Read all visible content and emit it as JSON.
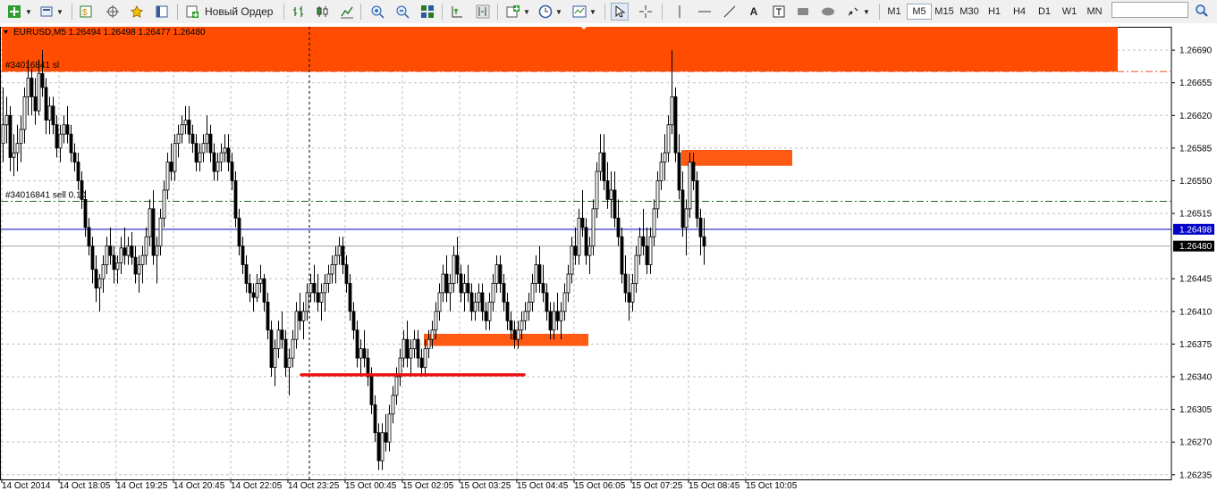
{
  "toolbar": {
    "new_order_label": "Новый Ордер",
    "timeframes": [
      "M1",
      "M5",
      "M15",
      "M30",
      "H1",
      "H4",
      "D1",
      "W1",
      "MN"
    ],
    "active_timeframe": "M5",
    "icons": [
      "new-chart-icon",
      "profiles-icon",
      "market-watch-icon",
      "navigator-icon",
      "favorites-icon",
      "data-window-icon",
      "new-order-icon",
      "bar-chart-icon",
      "candlestick-icon",
      "line-chart-icon",
      "zoom-in-icon",
      "zoom-out-icon",
      "tile-windows-icon",
      "autoscroll-icon",
      "chart-shift-icon",
      "indicators-icon",
      "periods-icon",
      "templates-icon",
      "cursor-icon",
      "crosshair-icon",
      "vertical-line-icon",
      "horizontal-line-icon",
      "trendline-icon",
      "text-icon",
      "text-label-icon",
      "rectangle-icon",
      "ellipse-icon",
      "arrows-icon",
      "search-icon"
    ]
  },
  "chart_data": {
    "type": "candlestick",
    "header": "EURUSD,M5  1.26494 1.26498 1.26477 1.26480",
    "symbol": "EURUSD",
    "timeframe": "M5",
    "ohlc": {
      "open": 1.26494,
      "high": 1.26498,
      "low": 1.26477,
      "close": 1.2648
    },
    "price_axis": {
      "min": 1.2623,
      "max": 1.26715,
      "ticks": [
        "1.26690",
        "1.26655",
        "1.26620",
        "1.26585",
        "1.26550",
        "1.26515",
        "1.26445",
        "1.26410",
        "1.26375",
        "1.26340",
        "1.26305",
        "1.26270",
        "1.26235"
      ]
    },
    "time_labels": [
      "14 Oct 2014",
      "14 Oct 18:05",
      "14 Oct 19:25",
      "14 Oct 20:45",
      "14 Oct 22:05",
      "14 Oct 23:25",
      "15 Oct 00:45",
      "15 Oct 02:05",
      "15 Oct 03:25",
      "15 Oct 04:45",
      "15 Oct 06:05",
      "15 Oct 07:25",
      "15 Oct 08:45",
      "15 Oct 10:05"
    ],
    "price_markers": [
      {
        "label": "1.26498",
        "price": 1.26498,
        "bg": "#0000c8",
        "fg": "#ffffff",
        "kind": "bid"
      },
      {
        "label": "1.26480",
        "price": 1.2648,
        "bg": "#000000",
        "fg": "#ffffff",
        "kind": "last"
      }
    ],
    "order_lines": [
      {
        "label": "#34016841 sl",
        "price": 1.26667,
        "color": "#e05020",
        "style": "dashdot"
      },
      {
        "label": "#34016841 sell 0.10",
        "price": 1.26528,
        "color": "#1f6b1f",
        "style": "dashdot"
      }
    ],
    "zones": [
      {
        "price_top": 1.26715,
        "price_bottom": 1.26667,
        "bar_from": 0,
        "bar_to": 312,
        "color": "#ff4c00"
      },
      {
        "price_top": 1.26583,
        "price_bottom": 1.26566,
        "bar_from": 190,
        "bar_to": 221,
        "color": "#ff5a14"
      },
      {
        "price_top": 1.26386,
        "price_bottom": 1.26373,
        "bar_from": 118,
        "bar_to": 164,
        "color": "#ff5a14"
      }
    ],
    "trend_line": {
      "from_bar": 84,
      "to_bar": 146,
      "price": 1.26342,
      "color": "#ee1111"
    },
    "vertical_marker_bar": 86,
    "candle_color": "#000000",
    "accent_colors": {
      "zone": "#ff4c00",
      "bid_line": "#0000c8",
      "sell_line": "#1f6b1f",
      "grid": "#c0c0c0"
    },
    "candles": [
      [
        1.2659,
        1.2665,
        1.2657,
        1.2661
      ],
      [
        1.2661,
        1.2664,
        1.2659,
        1.2662
      ],
      [
        1.2662,
        1.2663,
        1.2656,
        1.26575
      ],
      [
        1.26575,
        1.266,
        1.26555,
        1.2658
      ],
      [
        1.2658,
        1.2661,
        1.2656,
        1.2659
      ],
      [
        1.2659,
        1.2662,
        1.2657,
        1.26605
      ],
      [
        1.26605,
        1.2665,
        1.2659,
        1.2664
      ],
      [
        1.2664,
        1.2668,
        1.2662,
        1.2666
      ],
      [
        1.2666,
        1.2667,
        1.2662,
        1.2664
      ],
      [
        1.2664,
        1.2666,
        1.2661,
        1.26625
      ],
      [
        1.26625,
        1.2668,
        1.2662,
        1.26665
      ],
      [
        1.26665,
        1.2669,
        1.2664,
        1.2665
      ],
      [
        1.2665,
        1.2666,
        1.266,
        1.26615
      ],
      [
        1.26615,
        1.2664,
        1.266,
        1.2663
      ],
      [
        1.2663,
        1.2664,
        1.266,
        1.2661
      ],
      [
        1.2661,
        1.2662,
        1.26575,
        1.26585
      ],
      [
        1.26585,
        1.2661,
        1.2657,
        1.266
      ],
      [
        1.266,
        1.2662,
        1.2659,
        1.2661
      ],
      [
        1.2661,
        1.2663,
        1.2659,
        1.266
      ],
      [
        1.266,
        1.2661,
        1.2657,
        1.2658
      ],
      [
        1.2658,
        1.2659,
        1.2656,
        1.2657
      ],
      [
        1.2657,
        1.2658,
        1.2654,
        1.2655
      ],
      [
        1.2655,
        1.2656,
        1.2652,
        1.2653
      ],
      [
        1.2653,
        1.2654,
        1.2649,
        1.265
      ],
      [
        1.265,
        1.2651,
        1.2647,
        1.2648
      ],
      [
        1.2648,
        1.2649,
        1.2644,
        1.26455
      ],
      [
        1.26455,
        1.2647,
        1.2642,
        1.26435
      ],
      [
        1.26435,
        1.2645,
        1.2641,
        1.26445
      ],
      [
        1.26445,
        1.2647,
        1.2643,
        1.2646
      ],
      [
        1.2646,
        1.2649,
        1.2645,
        1.2648
      ],
      [
        1.2648,
        1.265,
        1.2646,
        1.2647
      ],
      [
        1.2647,
        1.2648,
        1.2644,
        1.26455
      ],
      [
        1.26455,
        1.2647,
        1.2644,
        1.26462
      ],
      [
        1.26462,
        1.2649,
        1.2645,
        1.26478
      ],
      [
        1.26478,
        1.265,
        1.2646,
        1.2647
      ],
      [
        1.2647,
        1.2649,
        1.2646,
        1.2648
      ],
      [
        1.2648,
        1.26495,
        1.2646,
        1.26468
      ],
      [
        1.26468,
        1.2648,
        1.2644,
        1.2645
      ],
      [
        1.2645,
        1.2647,
        1.2643,
        1.2646
      ],
      [
        1.2646,
        1.2648,
        1.2644,
        1.2647
      ],
      [
        1.2647,
        1.265,
        1.2646,
        1.2649
      ],
      [
        1.2649,
        1.2653,
        1.2648,
        1.2652
      ],
      [
        1.2652,
        1.2654,
        1.2646,
        1.2647
      ],
      [
        1.2647,
        1.2649,
        1.2644,
        1.2648
      ],
      [
        1.2648,
        1.2652,
        1.2647,
        1.2651
      ],
      [
        1.2651,
        1.2655,
        1.265,
        1.2654
      ],
      [
        1.2654,
        1.2658,
        1.2653,
        1.2657
      ],
      [
        1.2657,
        1.2659,
        1.2655,
        1.2656
      ],
      [
        1.2656,
        1.266,
        1.2655,
        1.2659
      ],
      [
        1.2659,
        1.2661,
        1.26575,
        1.266
      ],
      [
        1.266,
        1.2662,
        1.2659,
        1.2661
      ],
      [
        1.2661,
        1.2663,
        1.266,
        1.26615
      ],
      [
        1.26615,
        1.2663,
        1.2659,
        1.266
      ],
      [
        1.266,
        1.2661,
        1.2658,
        1.2659
      ],
      [
        1.2659,
        1.266,
        1.2656,
        1.2657
      ],
      [
        1.2657,
        1.2659,
        1.2656,
        1.2658
      ],
      [
        1.2658,
        1.266,
        1.2657,
        1.2659
      ],
      [
        1.2659,
        1.2662,
        1.2658,
        1.266
      ],
      [
        1.266,
        1.2661,
        1.2657,
        1.2658
      ],
      [
        1.2658,
        1.2659,
        1.2655,
        1.2656
      ],
      [
        1.2656,
        1.2658,
        1.2655,
        1.2657
      ],
      [
        1.2657,
        1.2659,
        1.2656,
        1.2658
      ],
      [
        1.2658,
        1.266,
        1.2657,
        1.26585
      ],
      [
        1.26585,
        1.266,
        1.2656,
        1.2657
      ],
      [
        1.2657,
        1.2658,
        1.2654,
        1.2655
      ],
      [
        1.2655,
        1.2656,
        1.265,
        1.2651
      ],
      [
        1.2651,
        1.2652,
        1.2647,
        1.2648
      ],
      [
        1.2648,
        1.2649,
        1.2645,
        1.2646
      ],
      [
        1.2646,
        1.2647,
        1.2643,
        1.2644
      ],
      [
        1.2644,
        1.2645,
        1.2642,
        1.2643
      ],
      [
        1.2643,
        1.2644,
        1.2641,
        1.26425
      ],
      [
        1.26425,
        1.2645,
        1.2642,
        1.2644
      ],
      [
        1.2644,
        1.2646,
        1.2643,
        1.26445
      ],
      [
        1.26445,
        1.2645,
        1.2641,
        1.2642
      ],
      [
        1.2642,
        1.2643,
        1.2638,
        1.2639
      ],
      [
        1.2639,
        1.264,
        1.2634,
        1.2635
      ],
      [
        1.2635,
        1.2638,
        1.2633,
        1.2637
      ],
      [
        1.2637,
        1.264,
        1.2636,
        1.2639
      ],
      [
        1.2639,
        1.2641,
        1.2637,
        1.2638
      ],
      [
        1.2638,
        1.2639,
        1.2634,
        1.2635
      ],
      [
        1.2635,
        1.2637,
        1.2632,
        1.2636
      ],
      [
        1.2636,
        1.2639,
        1.2635,
        1.2638
      ],
      [
        1.2638,
        1.2642,
        1.2637,
        1.2641
      ],
      [
        1.2641,
        1.2643,
        1.2639,
        1.264
      ],
      [
        1.264,
        1.2642,
        1.2638,
        1.2641
      ],
      [
        1.2641,
        1.2644,
        1.264,
        1.2643
      ],
      [
        1.2643,
        1.2645,
        1.2642,
        1.2644
      ],
      [
        1.2644,
        1.2646,
        1.2642,
        1.2643
      ],
      [
        1.2643,
        1.2645,
        1.2641,
        1.2642
      ],
      [
        1.2642,
        1.2644,
        1.264,
        1.2643
      ],
      [
        1.2643,
        1.2645,
        1.2641,
        1.2644
      ],
      [
        1.2644,
        1.2646,
        1.2643,
        1.2645
      ],
      [
        1.2645,
        1.2647,
        1.2644,
        1.2646
      ],
      [
        1.2646,
        1.2648,
        1.2644,
        1.2647
      ],
      [
        1.2647,
        1.2649,
        1.2646,
        1.2648
      ],
      [
        1.2648,
        1.2649,
        1.2645,
        1.2646
      ],
      [
        1.2646,
        1.2647,
        1.2643,
        1.2644
      ],
      [
        1.2644,
        1.2645,
        1.264,
        1.2641
      ],
      [
        1.2641,
        1.2642,
        1.2638,
        1.2639
      ],
      [
        1.2639,
        1.264,
        1.2635,
        1.2636
      ],
      [
        1.2636,
        1.2638,
        1.2634,
        1.2637
      ],
      [
        1.2637,
        1.2639,
        1.2635,
        1.2636
      ],
      [
        1.2636,
        1.2637,
        1.2633,
        1.2634
      ],
      [
        1.2634,
        1.2635,
        1.263,
        1.2631
      ],
      [
        1.2631,
        1.2632,
        1.2627,
        1.2628
      ],
      [
        1.2628,
        1.2629,
        1.2624,
        1.2625
      ],
      [
        1.2625,
        1.2629,
        1.2624,
        1.2628
      ],
      [
        1.2628,
        1.263,
        1.2626,
        1.2627
      ],
      [
        1.2627,
        1.2631,
        1.2626,
        1.263
      ],
      [
        1.263,
        1.2633,
        1.2629,
        1.2632
      ],
      [
        1.2632,
        1.2635,
        1.2631,
        1.2634
      ],
      [
        1.2634,
        1.2637,
        1.2633,
        1.2636
      ],
      [
        1.2636,
        1.2639,
        1.2635,
        1.2638
      ],
      [
        1.2638,
        1.264,
        1.2635,
        1.2636
      ],
      [
        1.2636,
        1.2638,
        1.2634,
        1.2637
      ],
      [
        1.2637,
        1.2639,
        1.2636,
        1.2638
      ],
      [
        1.2638,
        1.2639,
        1.2635,
        1.2636
      ],
      [
        1.2636,
        1.2637,
        1.2634,
        1.2635
      ],
      [
        1.2635,
        1.2638,
        1.2634,
        1.2637
      ],
      [
        1.2637,
        1.2639,
        1.2636,
        1.2638
      ],
      [
        1.2638,
        1.264,
        1.2637,
        1.2639
      ],
      [
        1.2639,
        1.2642,
        1.2638,
        1.2641
      ],
      [
        1.2641,
        1.2644,
        1.264,
        1.2643
      ],
      [
        1.2643,
        1.2646,
        1.2642,
        1.2645
      ],
      [
        1.2645,
        1.2647,
        1.2642,
        1.2643
      ],
      [
        1.2643,
        1.2645,
        1.2641,
        1.2644
      ],
      [
        1.2644,
        1.2648,
        1.2643,
        1.2647
      ],
      [
        1.2647,
        1.2649,
        1.2644,
        1.2645
      ],
      [
        1.2645,
        1.2646,
        1.2642,
        1.2643
      ],
      [
        1.2643,
        1.2645,
        1.2641,
        1.2644
      ],
      [
        1.2644,
        1.2646,
        1.2642,
        1.2643
      ],
      [
        1.2643,
        1.2644,
        1.264,
        1.2641
      ],
      [
        1.2641,
        1.2643,
        1.264,
        1.2642
      ],
      [
        1.2642,
        1.2644,
        1.2641,
        1.2643
      ],
      [
        1.2643,
        1.2644,
        1.264,
        1.2641
      ],
      [
        1.2641,
        1.2642,
        1.2639,
        1.264
      ],
      [
        1.264,
        1.2643,
        1.2639,
        1.2642
      ],
      [
        1.2642,
        1.2645,
        1.2641,
        1.2644
      ],
      [
        1.2644,
        1.2647,
        1.2643,
        1.2646
      ],
      [
        1.2646,
        1.2647,
        1.2643,
        1.2644
      ],
      [
        1.2644,
        1.2645,
        1.2641,
        1.2642
      ],
      [
        1.2642,
        1.2643,
        1.2639,
        1.264
      ],
      [
        1.264,
        1.2641,
        1.2638,
        1.2639
      ],
      [
        1.2639,
        1.264,
        1.2637,
        1.2638
      ],
      [
        1.2638,
        1.264,
        1.2637,
        1.2639
      ],
      [
        1.2639,
        1.2641,
        1.2638,
        1.264
      ],
      [
        1.264,
        1.2642,
        1.2639,
        1.2641
      ],
      [
        1.2641,
        1.2643,
        1.264,
        1.2642
      ],
      [
        1.2642,
        1.2645,
        1.2641,
        1.2644
      ],
      [
        1.2644,
        1.2647,
        1.2643,
        1.2646
      ],
      [
        1.2646,
        1.2648,
        1.2643,
        1.2644
      ],
      [
        1.2644,
        1.2646,
        1.2642,
        1.2643
      ],
      [
        1.2643,
        1.2644,
        1.264,
        1.2641
      ],
      [
        1.2641,
        1.2642,
        1.2638,
        1.2639
      ],
      [
        1.2639,
        1.2642,
        1.2638,
        1.2641
      ],
      [
        1.2641,
        1.2643,
        1.2639,
        1.264
      ],
      [
        1.264,
        1.2642,
        1.2638,
        1.2641
      ],
      [
        1.2641,
        1.2644,
        1.264,
        1.2643
      ],
      [
        1.2643,
        1.2646,
        1.2642,
        1.2645
      ],
      [
        1.2645,
        1.2649,
        1.2644,
        1.2648
      ],
      [
        1.2648,
        1.265,
        1.2646,
        1.2647
      ],
      [
        1.2647,
        1.2652,
        1.2646,
        1.2651
      ],
      [
        1.2651,
        1.2654,
        1.2649,
        1.265
      ],
      [
        1.265,
        1.2651,
        1.2646,
        1.2647
      ],
      [
        1.2647,
        1.2649,
        1.2645,
        1.2648
      ],
      [
        1.2648,
        1.2653,
        1.2647,
        1.2652
      ],
      [
        1.2652,
        1.2657,
        1.2651,
        1.2656
      ],
      [
        1.2656,
        1.266,
        1.2655,
        1.2658
      ],
      [
        1.2658,
        1.266,
        1.2654,
        1.2655
      ],
      [
        1.2655,
        1.2657,
        1.2652,
        1.2653
      ],
      [
        1.2653,
        1.2656,
        1.2651,
        1.2654
      ],
      [
        1.2654,
        1.2656,
        1.265,
        1.2651
      ],
      [
        1.2651,
        1.2653,
        1.2648,
        1.2649
      ],
      [
        1.2649,
        1.265,
        1.2644,
        1.2645
      ],
      [
        1.2645,
        1.2647,
        1.2642,
        1.2643
      ],
      [
        1.2643,
        1.2645,
        1.264,
        1.2642
      ],
      [
        1.2642,
        1.2645,
        1.2641,
        1.2644
      ],
      [
        1.2644,
        1.2648,
        1.2643,
        1.2647
      ],
      [
        1.2647,
        1.265,
        1.2646,
        1.2649
      ],
      [
        1.2649,
        1.2652,
        1.2647,
        1.2648
      ],
      [
        1.2648,
        1.265,
        1.2645,
        1.2646
      ],
      [
        1.2646,
        1.265,
        1.2645,
        1.2649
      ],
      [
        1.2649,
        1.2653,
        1.2648,
        1.2652
      ],
      [
        1.2652,
        1.2656,
        1.2651,
        1.2655
      ],
      [
        1.2655,
        1.2658,
        1.2654,
        1.2657
      ],
      [
        1.2657,
        1.266,
        1.2655,
        1.2658
      ],
      [
        1.2658,
        1.2662,
        1.2657,
        1.2661
      ],
      [
        1.2661,
        1.2669,
        1.266,
        1.2664
      ],
      [
        1.2664,
        1.2665,
        1.2657,
        1.2658
      ],
      [
        1.2658,
        1.266,
        1.2653,
        1.2654
      ],
      [
        1.2654,
        1.2656,
        1.2649,
        1.265
      ],
      [
        1.265,
        1.2653,
        1.2647,
        1.2652
      ],
      [
        1.2652,
        1.2658,
        1.2651,
        1.2657
      ],
      [
        1.2657,
        1.2658,
        1.2654,
        1.2655
      ],
      [
        1.2655,
        1.2656,
        1.265,
        1.2651
      ],
      [
        1.2651,
        1.2652,
        1.2647,
        1.2649
      ],
      [
        1.2649,
        1.2651,
        1.2646,
        1.2648
      ]
    ]
  }
}
